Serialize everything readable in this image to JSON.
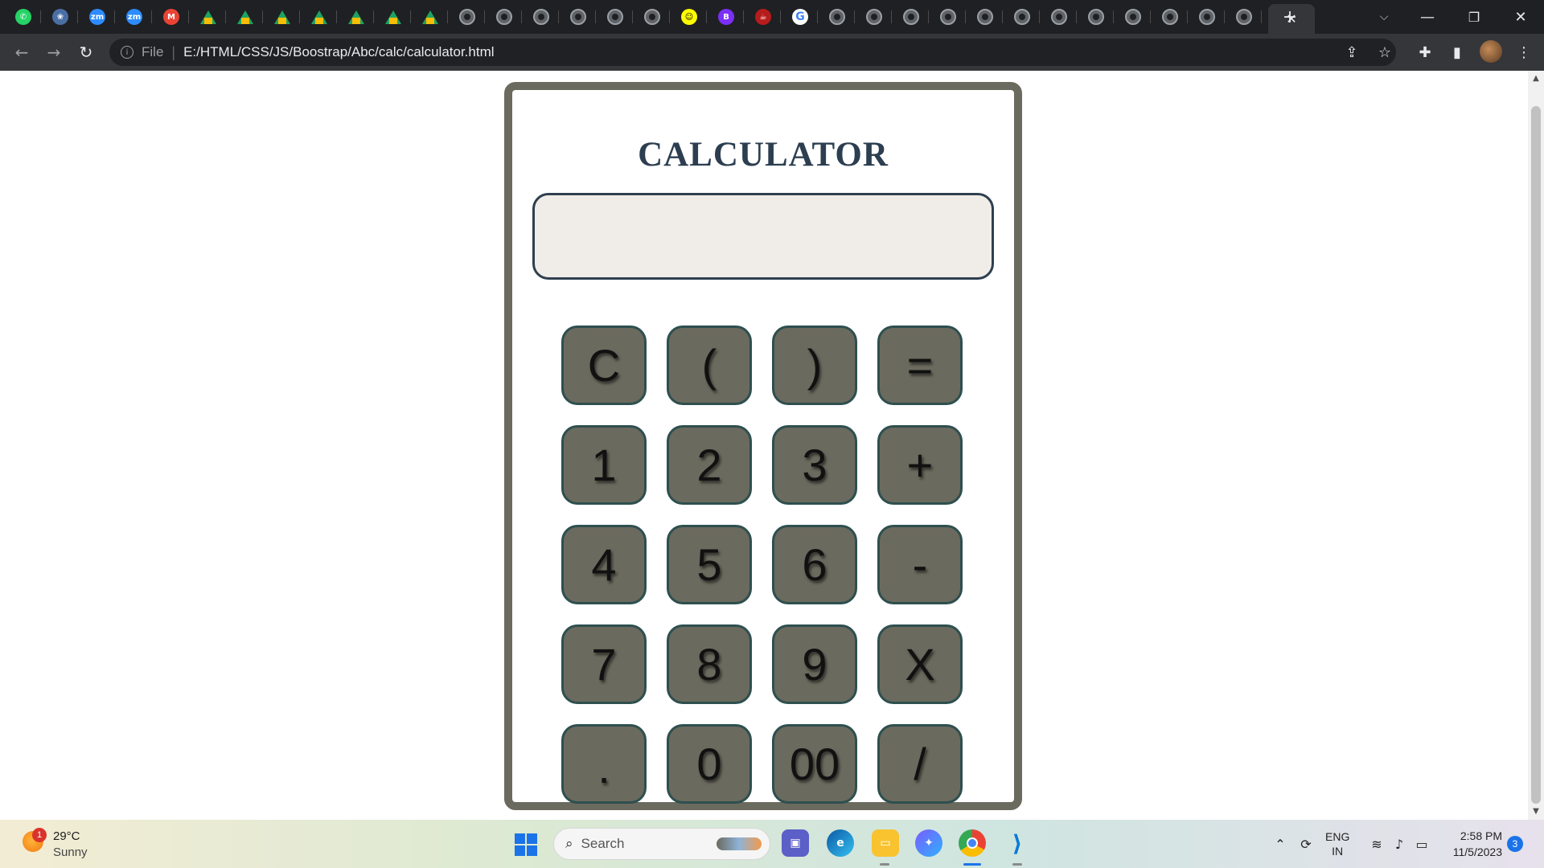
{
  "browser": {
    "address": {
      "scheme_label": "File",
      "url": "E:/HTML/CSS/JS/Boostrap/Abc/calc/calculator.html"
    },
    "window_controls": {
      "minimize": "—",
      "restore": "❐",
      "close": "✕"
    },
    "new_tab_label": "+",
    "tab_close_label": "✕"
  },
  "tabs": [
    {
      "icon": "whatsapp-icon",
      "color": "#25d366",
      "glyph": "✆"
    },
    {
      "icon": "app-icon",
      "color": "#4a6fa5",
      "glyph": "❀"
    },
    {
      "icon": "zoom-icon",
      "color": "#2d8cff",
      "glyph": "zm"
    },
    {
      "icon": "zoom-icon",
      "color": "#2d8cff",
      "glyph": "zm"
    },
    {
      "icon": "gmail-icon",
      "color": "#ea4335",
      "glyph": "M"
    },
    {
      "icon": "google-drive-icon",
      "color": "#1ea362",
      "glyph": ""
    },
    {
      "icon": "google-drive-icon",
      "color": "#1ea362",
      "glyph": ""
    },
    {
      "icon": "google-drive-icon",
      "color": "#1ea362",
      "glyph": ""
    },
    {
      "icon": "google-drive-icon",
      "color": "#1ea362",
      "glyph": ""
    },
    {
      "icon": "google-drive-icon",
      "color": "#1ea362",
      "glyph": ""
    },
    {
      "icon": "google-drive-icon",
      "color": "#1ea362",
      "glyph": ""
    },
    {
      "icon": "google-drive-icon",
      "color": "#1ea362",
      "glyph": ""
    },
    {
      "icon": "globe-icon",
      "color": "#5f6368",
      "glyph": ""
    },
    {
      "icon": "globe-icon",
      "color": "#5f6368",
      "glyph": ""
    },
    {
      "icon": "globe-icon",
      "color": "#5f6368",
      "glyph": ""
    },
    {
      "icon": "globe-icon",
      "color": "#5f6368",
      "glyph": ""
    },
    {
      "icon": "globe-icon",
      "color": "#5f6368",
      "glyph": ""
    },
    {
      "icon": "globe-icon",
      "color": "#5f6368",
      "glyph": ""
    },
    {
      "icon": "snapchat-icon",
      "color": "#fffc00",
      "glyph": "☺"
    },
    {
      "icon": "b-icon",
      "color": "#7b2ff7",
      "glyph": "B"
    },
    {
      "icon": "coffee-icon",
      "color": "#b71c1c",
      "glyph": "☕"
    },
    {
      "icon": "google-icon",
      "color": "#ffffff",
      "glyph": "G"
    },
    {
      "icon": "globe-icon",
      "color": "#5f6368",
      "glyph": ""
    },
    {
      "icon": "globe-icon",
      "color": "#5f6368",
      "glyph": ""
    },
    {
      "icon": "globe-icon",
      "color": "#5f6368",
      "glyph": ""
    },
    {
      "icon": "globe-icon",
      "color": "#5f6368",
      "glyph": ""
    },
    {
      "icon": "globe-icon",
      "color": "#5f6368",
      "glyph": ""
    },
    {
      "icon": "globe-icon",
      "color": "#5f6368",
      "glyph": ""
    },
    {
      "icon": "globe-icon",
      "color": "#5f6368",
      "glyph": ""
    },
    {
      "icon": "globe-icon",
      "color": "#5f6368",
      "glyph": ""
    },
    {
      "icon": "globe-icon",
      "color": "#5f6368",
      "glyph": ""
    },
    {
      "icon": "globe-icon",
      "color": "#5f6368",
      "glyph": ""
    },
    {
      "icon": "globe-icon",
      "color": "#5f6368",
      "glyph": ""
    },
    {
      "icon": "globe-icon",
      "color": "#5f6368",
      "glyph": ""
    }
  ],
  "calculator": {
    "title": "CALCULATOR",
    "display_value": "",
    "keys": [
      "C",
      "(",
      ")",
      "=",
      "1",
      "2",
      "3",
      "+",
      "4",
      "5",
      "6",
      "-",
      "7",
      "8",
      "9",
      "X",
      ".",
      "0",
      "00",
      "/"
    ],
    "colors": {
      "frame": "#6b6a5e",
      "key": "#6b6a5e",
      "key_border": "#2e4f4f",
      "display_bg": "#f0ece8",
      "title": "#2c3e50"
    }
  },
  "taskbar": {
    "weather": {
      "temp": "29°C",
      "condition": "Sunny",
      "badge": "1"
    },
    "search_label": "Search",
    "language": {
      "line1": "ENG",
      "line2": "IN"
    },
    "clock": {
      "time": "2:58 PM",
      "date": "11/5/2023"
    },
    "notification_count": "3"
  }
}
